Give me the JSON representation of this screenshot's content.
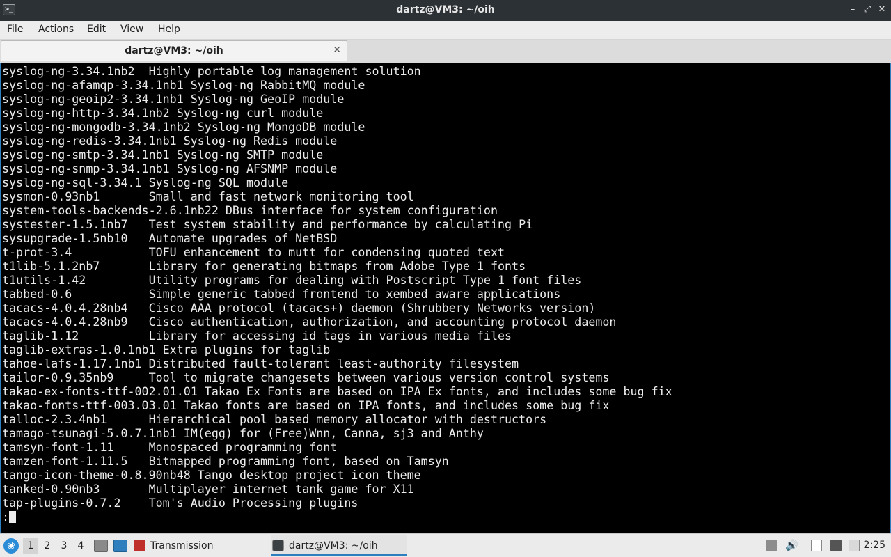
{
  "window": {
    "title": "dartz@VM3: ~/oih",
    "controls": {
      "minimize": "–",
      "restore": "⤢",
      "close": "✕"
    }
  },
  "menu": [
    "File",
    "Actions",
    "Edit",
    "View",
    "Help"
  ],
  "tab": {
    "label": "dartz@VM3: ~/oih",
    "close": "✕"
  },
  "terminal": {
    "lines": [
      "syslog-ng-3.34.1nb2  Highly portable log management solution",
      "syslog-ng-afamqp-3.34.1nb1 Syslog-ng RabbitMQ module",
      "syslog-ng-geoip2-3.34.1nb1 Syslog-ng GeoIP module",
      "syslog-ng-http-3.34.1nb2 Syslog-ng curl module",
      "syslog-ng-mongodb-3.34.1nb2 Syslog-ng MongoDB module",
      "syslog-ng-redis-3.34.1nb1 Syslog-ng Redis module",
      "syslog-ng-smtp-3.34.1nb1 Syslog-ng SMTP module",
      "syslog-ng-snmp-3.34.1nb1 Syslog-ng AFSNMP module",
      "syslog-ng-sql-3.34.1 Syslog-ng SQL module",
      "sysmon-0.93nb1       Small and fast network monitoring tool",
      "system-tools-backends-2.6.1nb22 DBus interface for system configuration",
      "systester-1.5.1nb7   Test system stability and performance by calculating Pi",
      "sysupgrade-1.5nb10   Automate upgrades of NetBSD",
      "t-prot-3.4           TOFU enhancement to mutt for condensing quoted text",
      "t1lib-5.1.2nb7       Library for generating bitmaps from Adobe Type 1 fonts",
      "t1utils-1.42         Utility programs for dealing with Postscript Type 1 font files",
      "tabbed-0.6           Simple generic tabbed frontend to xembed aware applications",
      "tacacs-4.0.4.28nb4   Cisco AAA protocol (tacacs+) daemon (Shrubbery Networks version)",
      "tacacs-4.0.4.28nb9   Cisco authentication, authorization, and accounting protocol daemon",
      "taglib-1.12          Library for accessing id tags in various media files",
      "taglib-extras-1.0.1nb1 Extra plugins for taglib",
      "tahoe-lafs-1.17.1nb1 Distributed fault-tolerant least-authority filesystem",
      "tailor-0.9.35nb9     Tool to migrate changesets between various version control systems",
      "takao-ex-fonts-ttf-002.01.01 Takao Ex Fonts are based on IPA Ex fonts, and includes some bug fix",
      "takao-fonts-ttf-003.03.01 Takao fonts are based on IPA fonts, and includes some bug fix",
      "talloc-2.3.4nb1      Hierarchical pool based memory allocator with destructors",
      "tamago-tsunagi-5.0.7.1nb1 IM(egg) for (Free)Wnn, Canna, sj3 and Anthy",
      "tamsyn-font-1.11     Monospaced programming font",
      "tamzen-font-1.11.5   Bitmapped programming font, based on Tamsyn",
      "tango-icon-theme-0.8.90nb48 Tango desktop project icon theme",
      "tanked-0.90nb3       Multiplayer internet tank game for X11",
      "tap-plugins-0.7.2    Tom's Audio Processing plugins"
    ],
    "prompt": ":"
  },
  "taskbar": {
    "workspaces": [
      "1",
      "2",
      "3",
      "4"
    ],
    "active_workspace": "1",
    "tasks": [
      {
        "label": "Transmission",
        "icon": "transmission-icon"
      },
      {
        "label": "dartz@VM3: ~/oih",
        "icon": "terminal-icon"
      }
    ],
    "clock": "2:25"
  },
  "colors": {
    "titlebar_bg": "#2c3135",
    "terminal_bg": "#000000",
    "terminal_fg": "#ececec",
    "accent": "#2f7fbf"
  }
}
